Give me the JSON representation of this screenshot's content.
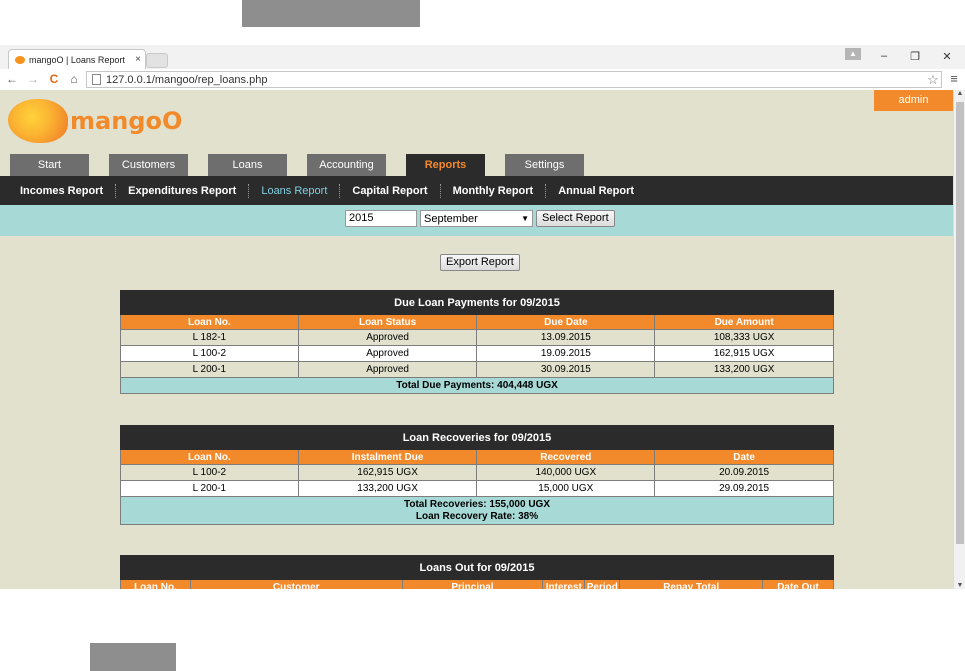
{
  "browser": {
    "tab_title": "mangoO | Loans Report",
    "tab_close": "×",
    "url": "127.0.0.1/mangoo/rep_loans.php",
    "back": "←",
    "forward": "→",
    "reload": "C",
    "home": "⌂",
    "star": "☆",
    "menu": "≡",
    "minimize": "–",
    "maximize": "❐",
    "close": "✕",
    "user": "▲"
  },
  "header": {
    "admin_label": "admin",
    "logo_text": "mangoO"
  },
  "main_tabs": [
    "Start",
    "Customers",
    "Loans",
    "Accounting",
    "Reports",
    "Settings"
  ],
  "sub_nav": [
    "Incomes Report",
    "Expenditures Report",
    "Loans Report",
    "Capital Report",
    "Monthly Report",
    "Annual Report"
  ],
  "filter": {
    "year": "2015",
    "month": "September",
    "select_button": "Select Report"
  },
  "export_button": "Export Report",
  "due_table": {
    "title": "Due Loan Payments for 09/2015",
    "columns": [
      "Loan No.",
      "Loan Status",
      "Due Date",
      "Due Amount"
    ],
    "rows": [
      [
        "L 182-1",
        "Approved",
        "13.09.2015",
        "108,333 UGX"
      ],
      [
        "L 100-2",
        "Approved",
        "19.09.2015",
        "162,915 UGX"
      ],
      [
        "L 200-1",
        "Approved",
        "30.09.2015",
        "133,200 UGX"
      ]
    ],
    "total": "Total Due Payments: 404,448 UGX"
  },
  "recovery_table": {
    "title": "Loan Recoveries for 09/2015",
    "columns": [
      "Loan No.",
      "Instalment Due",
      "Recovered",
      "Date"
    ],
    "rows": [
      [
        "L 100-2",
        "162,915 UGX",
        "140,000 UGX",
        "20.09.2015"
      ],
      [
        "L 200-1",
        "133,200 UGX",
        "15,000 UGX",
        "29.09.2015"
      ]
    ],
    "total_line1": "Total Recoveries: 155,000 UGX",
    "total_line2": "Loan Recovery Rate: 38%"
  },
  "loans_out_table": {
    "title": "Loans Out for 09/2015",
    "columns": [
      "Loan No.",
      "Customer",
      "Principal",
      "Interest",
      "Period",
      "Repay Total",
      "Date Out"
    ]
  }
}
